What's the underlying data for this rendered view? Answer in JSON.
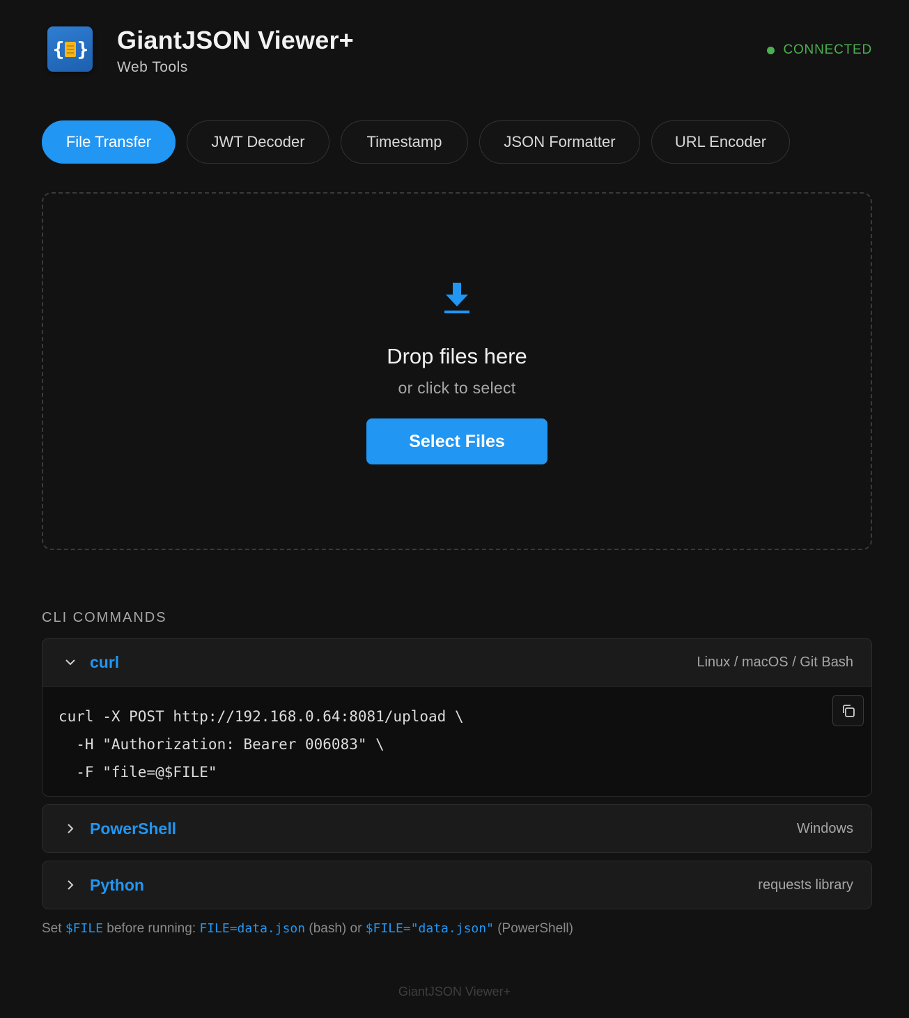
{
  "app": {
    "title": "GiantJSON Viewer+",
    "subtitle": "Web Tools",
    "status": "CONNECTED",
    "status_color": "#4caf50",
    "accent": "#2196f3"
  },
  "tabs": [
    {
      "label": "File Transfer",
      "active": true
    },
    {
      "label": "JWT Decoder"
    },
    {
      "label": "Timestamp"
    },
    {
      "label": "JSON Formatter"
    },
    {
      "label": "URL Encoder"
    }
  ],
  "dropzone": {
    "icon": "download-icon",
    "title": "Drop files here",
    "subtitle": "or click to select",
    "button": "Select Files"
  },
  "cli": {
    "heading": "CLI COMMANDS",
    "sections": [
      {
        "name": "curl",
        "meta": "Linux / macOS / Git Bash",
        "expanded": true,
        "code": [
          "curl -X POST http://192.168.0.64:8081/upload \\",
          "  -H \"Authorization: Bearer 006083\" \\",
          "  -F \"file=@$FILE\""
        ],
        "copy_icon": "copy-icon"
      },
      {
        "name": "PowerShell",
        "meta": "Windows",
        "expanded": false
      },
      {
        "name": "Python",
        "meta": "requests library",
        "expanded": false
      }
    ],
    "note": {
      "p1": "Set ",
      "v1": "$FILE",
      "p2": " before running: ",
      "v2": "FILE=data.json",
      "p3": " (bash) or ",
      "v3": "$FILE=\"data.json\"",
      "p4": " (PowerShell)"
    }
  },
  "footer": "GiantJSON Viewer+"
}
